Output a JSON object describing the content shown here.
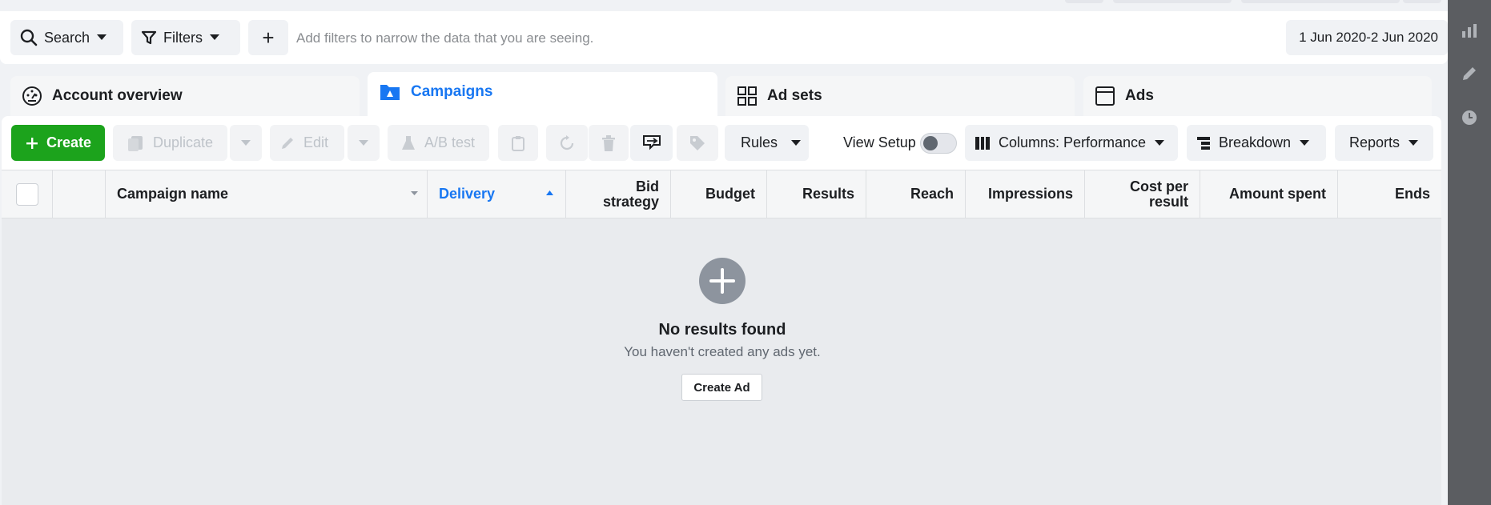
{
  "filterbar": {
    "search_label": "Search",
    "filters_label": "Filters",
    "add_label": "+",
    "hint": "Add filters to narrow the data that you are seeing.",
    "date_range": "1 Jun 2020-2 Jun 2020"
  },
  "tabs": [
    {
      "label": "Account overview",
      "icon": "gauge-icon"
    },
    {
      "label": "Campaigns",
      "icon": "folder-icon"
    },
    {
      "label": "Ad sets",
      "icon": "grid-icon"
    },
    {
      "label": "Ads",
      "icon": "window-icon"
    }
  ],
  "toolbar": {
    "create": "Create",
    "duplicate": "Duplicate",
    "edit": "Edit",
    "ab_test": "A/B test",
    "rules": "Rules",
    "view_setup": "View Setup",
    "columns": "Columns: Performance",
    "breakdown": "Breakdown",
    "reports": "Reports"
  },
  "table": {
    "columns": [
      "Campaign name",
      "Delivery",
      "Bid strategy",
      "Budget",
      "Results",
      "Reach",
      "Impressions",
      "Cost per result",
      "Amount spent",
      "Ends"
    ],
    "sorted_column": "Delivery"
  },
  "empty_state": {
    "title": "No results found",
    "subtitle": "You haven't created any ads yet.",
    "button": "Create Ad"
  },
  "colors": {
    "accent": "#1877f2",
    "create_green": "#1ca31c",
    "rail": "#5b5d61"
  }
}
